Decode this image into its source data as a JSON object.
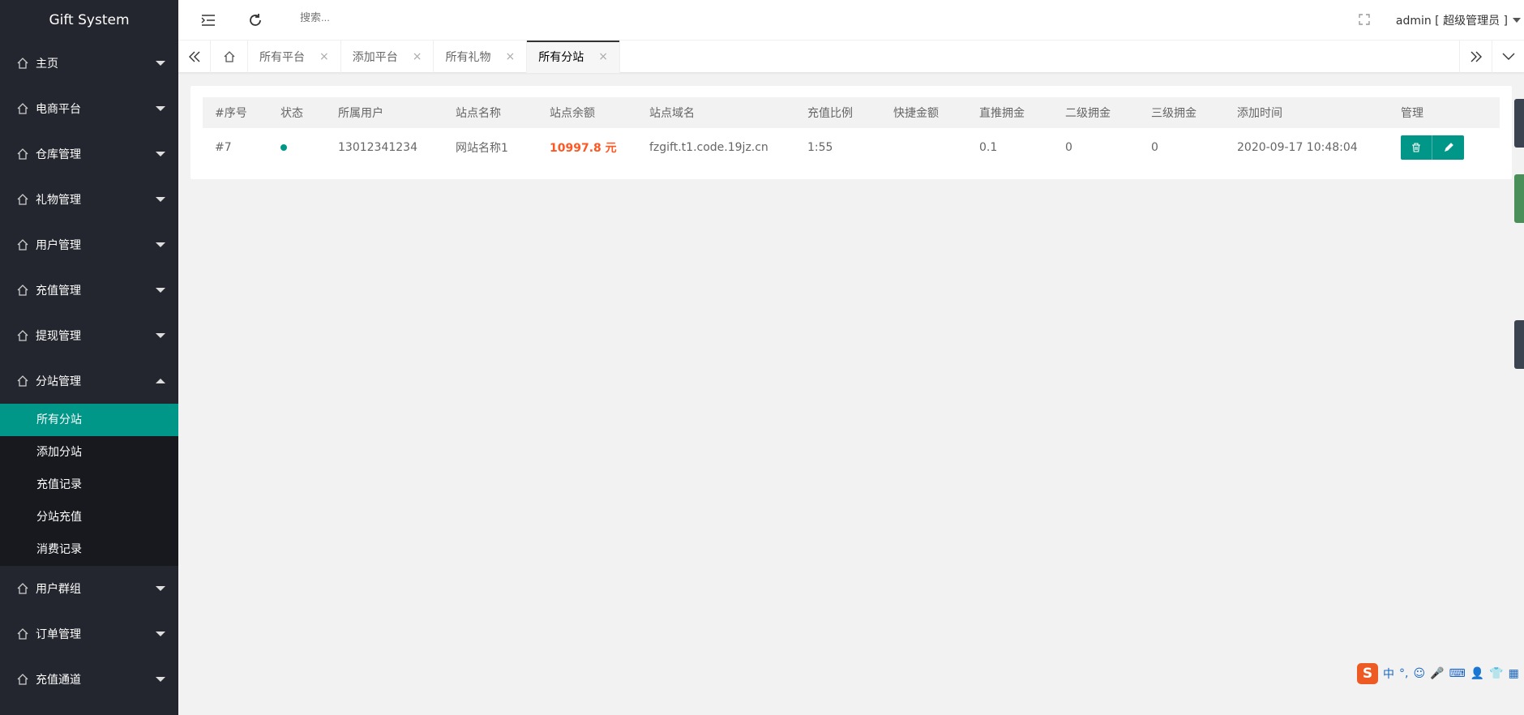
{
  "app": {
    "title": "Gift System"
  },
  "sidebar": {
    "items": [
      {
        "label": "主页",
        "expanded": false
      },
      {
        "label": "电商平台",
        "expanded": false
      },
      {
        "label": "仓库管理",
        "expanded": false
      },
      {
        "label": "礼物管理",
        "expanded": false
      },
      {
        "label": "用户管理",
        "expanded": false
      },
      {
        "label": "充值管理",
        "expanded": false
      },
      {
        "label": "提现管理",
        "expanded": false
      },
      {
        "label": "分站管理",
        "expanded": true
      }
    ],
    "subitems": [
      {
        "label": "所有分站",
        "active": true
      },
      {
        "label": "添加分站"
      },
      {
        "label": "充值记录"
      },
      {
        "label": "分站充值"
      },
      {
        "label": "消费记录"
      }
    ],
    "items_after": [
      {
        "label": "用户群组"
      },
      {
        "label": "订单管理"
      },
      {
        "label": "充值通道"
      }
    ]
  },
  "header": {
    "search_placeholder": "搜索...",
    "user_label": "admin [ 超级管理员 ]"
  },
  "tabs": [
    {
      "label": "所有平台",
      "close": "×"
    },
    {
      "label": "添加平台",
      "close": "×"
    },
    {
      "label": "所有礼物",
      "close": "×"
    },
    {
      "label": "所有分站",
      "close": "×",
      "active": true
    }
  ],
  "table": {
    "columns": [
      "#序号",
      "状态",
      "所属用户",
      "站点名称",
      "站点余额",
      "站点域名",
      "充值比例",
      "快捷金额",
      "直推拥金",
      "二级拥金",
      "三级拥金",
      "添加时间",
      "管理"
    ],
    "rows": [
      {
        "id": "#7",
        "status": "active",
        "user": "13012341234",
        "site_name": "网站名称1",
        "balance": "10997.8 元",
        "domain": "fzgift.t1.code.19jz.cn",
        "ratio": "1:55",
        "quick_amount": "",
        "direct_commission": "0.1",
        "level2_commission": "0",
        "level3_commission": "0",
        "added_time": "2020-09-17 10:48:04"
      }
    ]
  },
  "ime": {
    "mode": "中",
    "punct": "°,"
  },
  "colors": {
    "accent": "#009688",
    "sidebar_bg": "#23262e",
    "balance": "#ff5722"
  }
}
